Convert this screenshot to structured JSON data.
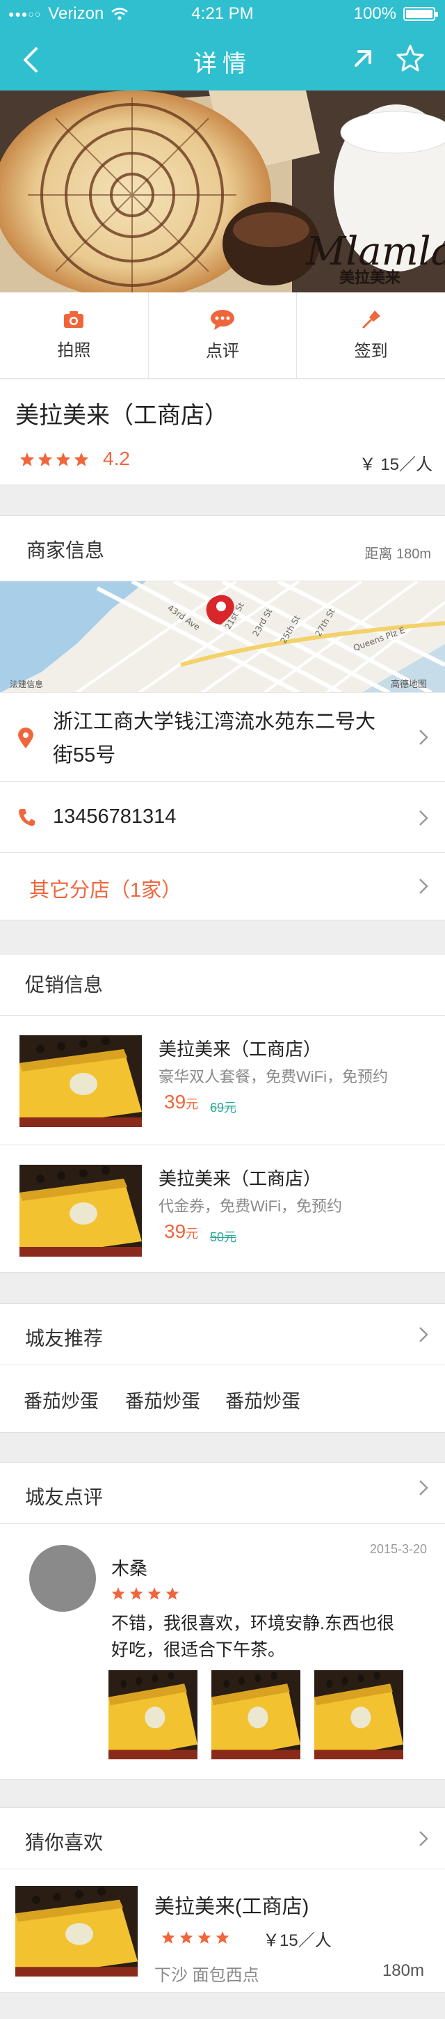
{
  "status": {
    "carrier": "Verizon",
    "time": "4:21 PM",
    "battery": "100%",
    "battery_level": 1.0
  },
  "nav": {
    "title": "详情"
  },
  "hero": {
    "brand": "Mlamlai",
    "brand_cn": "美拉美来"
  },
  "actions": [
    {
      "label": "拍照",
      "icon": "camera-icon"
    },
    {
      "label": "点评",
      "icon": "comment-icon"
    },
    {
      "label": "签到",
      "icon": "pin-icon"
    }
  ],
  "shop": {
    "name": "美拉美来（工商店）",
    "rating": "4.2",
    "stars": 4,
    "price": "￥ 15／人"
  },
  "merchant": {
    "title": "商家信息",
    "distance": "距离 180m",
    "map_credit": "法建信息",
    "map_brand": "高德地图",
    "address": "浙江工商大学钱江湾流水苑东二号大街55号",
    "phone": "13456781314",
    "branches": "其它分店（1家）"
  },
  "promo": {
    "title": "促销信息",
    "items": [
      {
        "title": "美拉美来（工商店）",
        "desc": "豪华双人套餐，免费WiFi，免预约",
        "price": "39",
        "unit": "元",
        "old": "69元"
      },
      {
        "title": "美拉美来（工商店）",
        "desc": "代金券，免费WiFi，免预约",
        "price": "39",
        "unit": "元",
        "old": "50元"
      }
    ]
  },
  "recommend": {
    "title": "城友推荐",
    "tags": [
      "番茄炒蛋",
      "番茄炒蛋",
      "番茄炒蛋"
    ]
  },
  "reviews": {
    "title": "城友点评",
    "items": [
      {
        "name": "木桑",
        "date": "2015-3-20",
        "stars": 4,
        "text": "不错，我很喜欢，环境安静.东西也很好吃，很适合下午茶。"
      }
    ]
  },
  "guess": {
    "title": "猜你喜欢",
    "items": [
      {
        "title": "美拉美来(工商店)",
        "stars": 4,
        "price": "￥15／人",
        "area": "下沙  面包西点",
        "distance": "180m"
      }
    ]
  },
  "colors": {
    "primary": "#2fbfcf",
    "accent": "#f0663c",
    "old_price": "#2aa79b"
  }
}
